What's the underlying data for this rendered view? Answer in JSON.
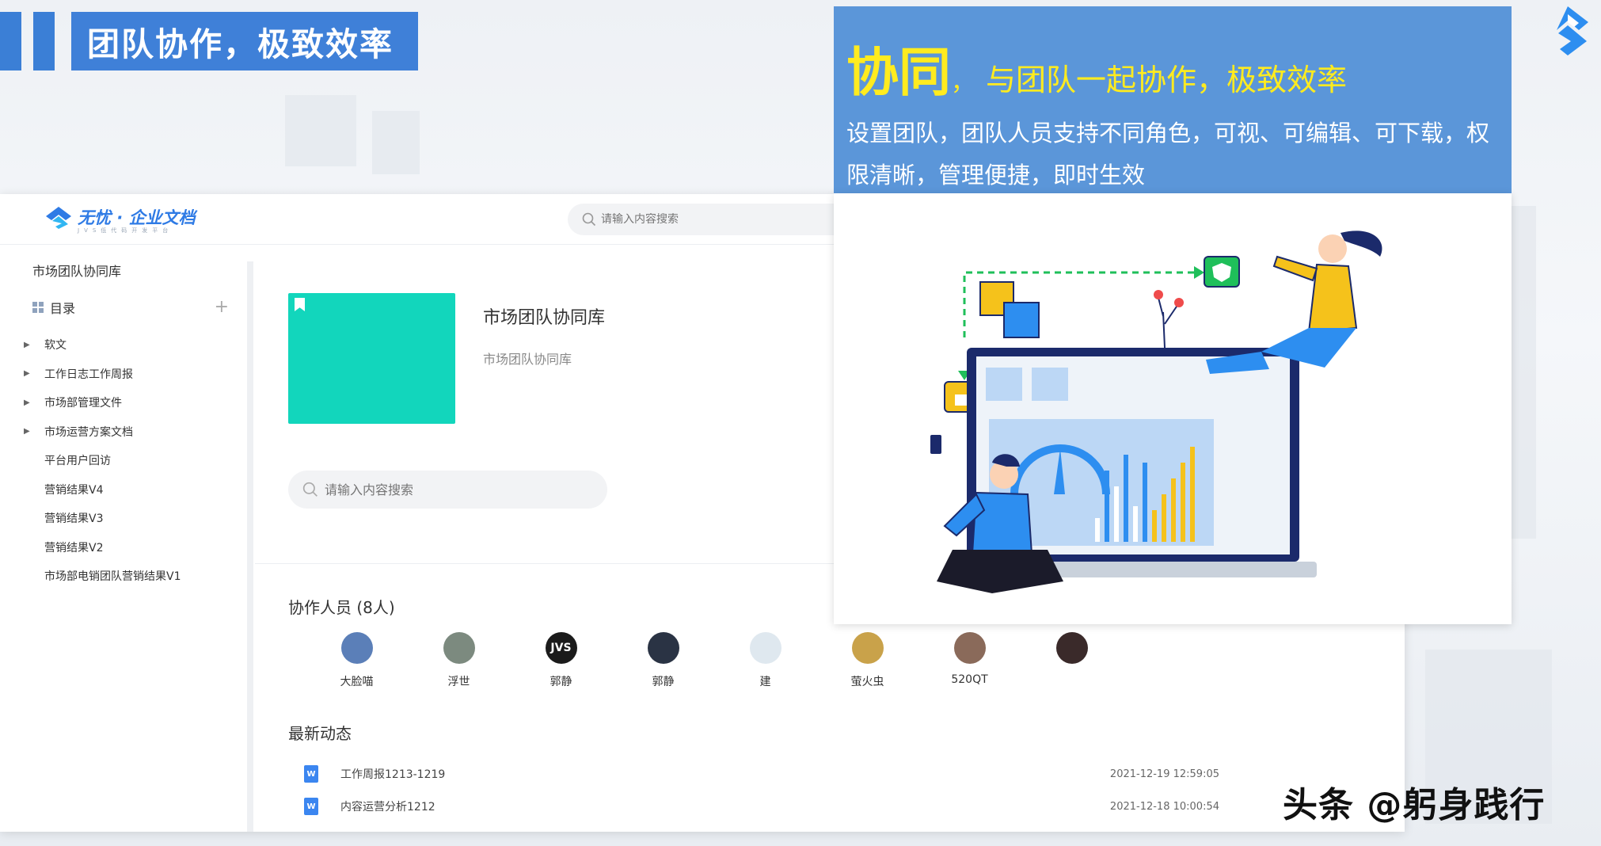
{
  "banner": {
    "title": "团队协作，极致效率"
  },
  "colors": {
    "accent": "#3f80d8",
    "teal": "#12d6bc",
    "panel": "#5b96d9",
    "highlight": "#ffeb1f"
  },
  "app": {
    "brand": {
      "name": "无忧 · 企业文档",
      "tagline": "JVS低代码开发平台"
    },
    "header_search_placeholder": "请输入内容搜索",
    "sidebar": {
      "library_name": "市场团队协同库",
      "toc_label": "目录",
      "items": [
        {
          "label": "软文",
          "expandable": true
        },
        {
          "label": "工作日志工作周报",
          "expandable": true
        },
        {
          "label": "市场部管理文件",
          "expandable": true
        },
        {
          "label": "市场运营方案文档",
          "expandable": true
        },
        {
          "label": "平台用户回访",
          "expandable": false
        },
        {
          "label": "营销结果V4",
          "expandable": false
        },
        {
          "label": "营销结果V3",
          "expandable": false
        },
        {
          "label": "营销结果V2",
          "expandable": false
        },
        {
          "label": "市场部电销团队营销结果V1",
          "expandable": false
        }
      ]
    },
    "main": {
      "library_title": "市场团队协同库",
      "library_desc": "市场团队协同库",
      "search_placeholder": "请输入内容搜索",
      "members_title": "协作人员 (8人)",
      "members": [
        {
          "name": "大脸喵",
          "color": "#5b7fb8"
        },
        {
          "name": "浮世",
          "color": "#7c8a7f"
        },
        {
          "name": "郭静",
          "color": "#1b1b1b"
        },
        {
          "name": "郭静",
          "color": "#2a3344"
        },
        {
          "name": "建",
          "color": "#dfe8ef"
        },
        {
          "name": "萤火虫",
          "color": "#c9a24a"
        },
        {
          "name": "520QT",
          "color": "#8a6a5a"
        },
        {
          "name": "",
          "color": "#3a2a2a"
        }
      ],
      "recent_title": "最新动态",
      "recent": [
        {
          "name": "工作周报1213-1219",
          "time": "2021-12-19 12:59:05"
        },
        {
          "name": "内容运营分析1212",
          "time": "2021-12-18 10:00:54"
        }
      ]
    }
  },
  "info": {
    "big": "协同",
    "comma": "，",
    "sub": "与团队一起协作，极致效率",
    "desc": "设置团队，团队人员支持不同角色，可视、可编辑、可下载，权限清晰，管理便捷，即时生效"
  },
  "watermark": "头条 @躬身践行"
}
